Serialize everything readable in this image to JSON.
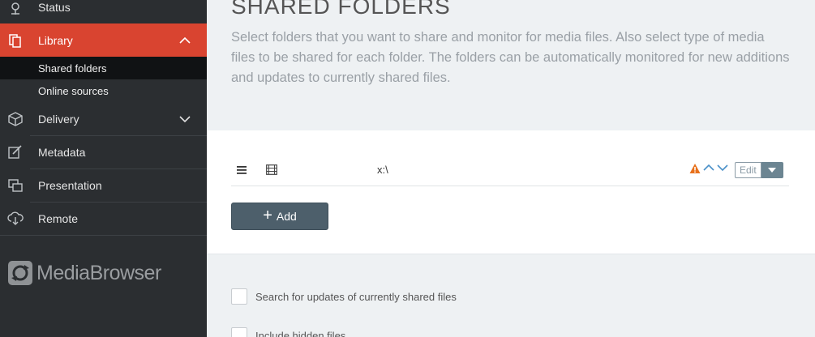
{
  "sidebar": {
    "status_label": "Status",
    "library_label": "Library",
    "library_sub": {
      "shared_folders": "Shared folders",
      "online_sources": "Online sources"
    },
    "delivery_label": "Delivery",
    "metadata_label": "Metadata",
    "presentation_label": "Presentation",
    "remote_label": "Remote",
    "brand": "MediaBrowser",
    "active_color": "#d94430"
  },
  "main": {
    "title": "SHARED FOLDERS",
    "description": "Select folders that you want to share and monitor for media files. Also select type of media files to be shared for each folder. The folders can be automatically monitored for new additions and updates to currently shared files.",
    "folders": [
      {
        "path": "x:\\",
        "media_type_icon": "film-icon",
        "warning": true,
        "edit_label": "Edit"
      }
    ],
    "add_label": "Add",
    "options": {
      "search_updates": "Search for updates of currently shared files",
      "include_hidden": "Include hidden files"
    }
  }
}
